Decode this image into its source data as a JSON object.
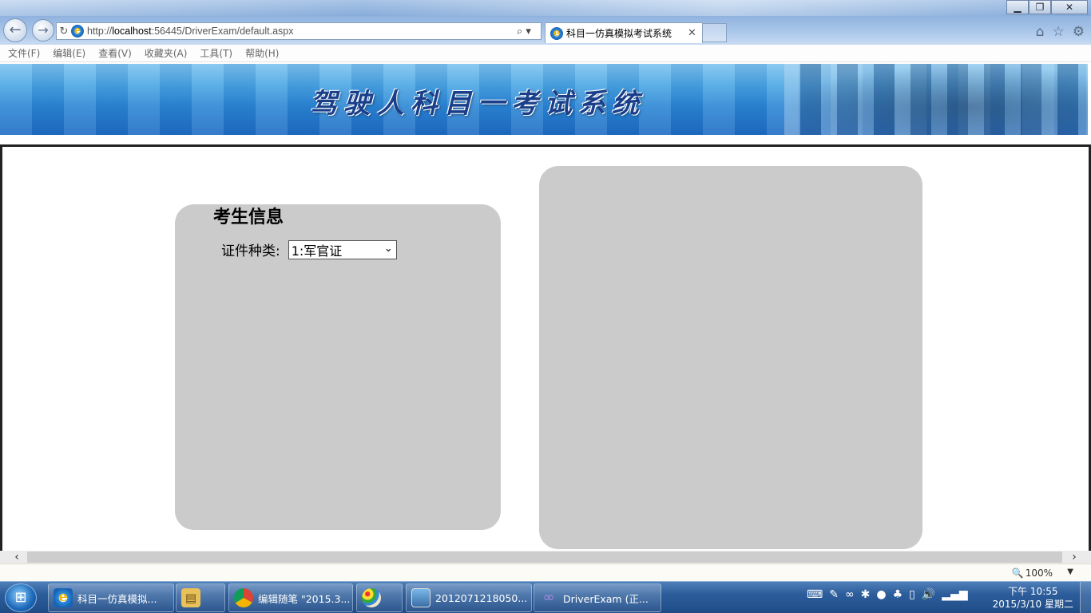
{
  "browser": {
    "url_prefix": "http://",
    "url_host": "localhost",
    "url_rest": ":56445/DriverExam/default.aspx",
    "tab_title": "科目一仿真模拟考试系统",
    "menu": [
      "文件(F)",
      "编辑(E)",
      "查看(V)",
      "收藏夹(A)",
      "工具(T)",
      "帮助(H)"
    ]
  },
  "page": {
    "banner_title": "驾驶人科目一考试系统",
    "candidate_panel": {
      "title": "考生信息",
      "id_type_label": "证件种类:",
      "id_type_value": "1:军官证"
    }
  },
  "status": {
    "zoom": "100%"
  },
  "taskbar": {
    "tasks": [
      "科目一仿真模拟...",
      "",
      "编辑随笔 \"2015.3...",
      "",
      "2012071218050...",
      "DriverExam (正..."
    ],
    "clock_time": "下午 10:55",
    "clock_date": "2015/3/10 星期二"
  },
  "colors": {
    "panel_bg": "#cbcbcb",
    "banner_blue": "#2b86d4",
    "taskbar_blue": "#2c5d9b"
  }
}
